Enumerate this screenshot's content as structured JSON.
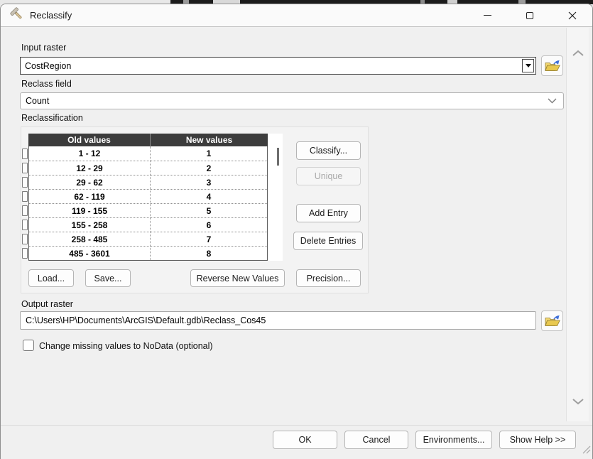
{
  "window": {
    "title": "Reclassify"
  },
  "fields": {
    "input_raster": {
      "label": "Input raster",
      "value": "CostRegion"
    },
    "reclass_field": {
      "label": "Reclass field",
      "value": "Count"
    },
    "reclassification_label": "Reclassification",
    "output_raster": {
      "label": "Output raster",
      "value": "C:\\Users\\HP\\Documents\\ArcGIS\\Default.gdb\\Reclass_Cos45"
    },
    "nodata_checkbox": {
      "label": "Change missing values to NoData (optional)",
      "checked": false
    }
  },
  "table": {
    "headers": {
      "old": "Old values",
      "new": "New values"
    },
    "rows": [
      {
        "old": "1 - 12",
        "new": "1"
      },
      {
        "old": "12 - 29",
        "new": "2"
      },
      {
        "old": "29 - 62",
        "new": "3"
      },
      {
        "old": "62 - 119",
        "new": "4"
      },
      {
        "old": "119 - 155",
        "new": "5"
      },
      {
        "old": "155 - 258",
        "new": "6"
      },
      {
        "old": "258 - 485",
        "new": "7"
      },
      {
        "old": "485 - 3601",
        "new": "8"
      }
    ]
  },
  "buttons": {
    "classify": "Classify...",
    "unique": "Unique",
    "add_entry": "Add Entry",
    "delete_entries": "Delete Entries",
    "load": "Load...",
    "save": "Save...",
    "reverse": "Reverse New Values",
    "precision": "Precision...",
    "ok": "OK",
    "cancel": "Cancel",
    "environments": "Environments...",
    "show_help": "Show Help >>"
  },
  "colors": {
    "table_header_bg": "#3c3c3c",
    "dialog_bg": "#f0f0f0",
    "folder_gold": "#e8c84f",
    "arrow_blue": "#3e6fd9"
  }
}
